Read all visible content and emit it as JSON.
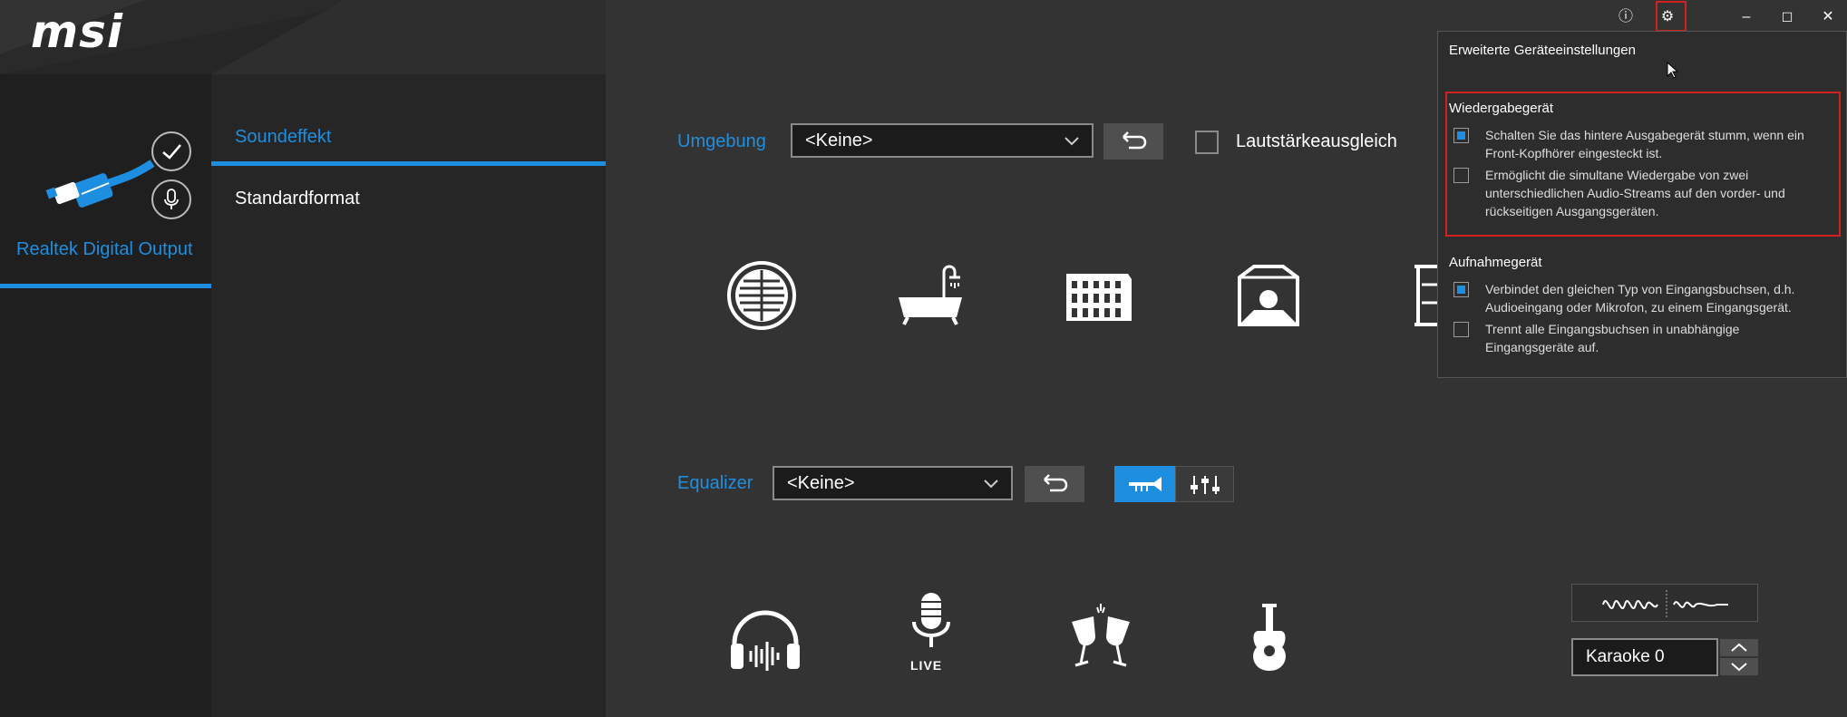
{
  "window": {
    "logo_text": "msi",
    "controls": {
      "info": "ⓘ",
      "settings": "⚙",
      "minimize": "–",
      "maximize": "☐",
      "close": "✕"
    }
  },
  "device": {
    "name": "Realtek Digital Output"
  },
  "nav": {
    "items": [
      {
        "label": "Soundeffekt",
        "selected": true
      },
      {
        "label": "Standardformat",
        "selected": false
      }
    ]
  },
  "environment": {
    "label": "Umgebung",
    "selected": "<Keine>",
    "loudness_label": "Lautstärkeausgleich",
    "loudness_checked": false,
    "icons": [
      "underwater-icon",
      "bathroom-icon",
      "colosseum-icon",
      "room-icon",
      "hall-icon"
    ]
  },
  "equalizer": {
    "label": "Equalizer",
    "selected": "<Keine>",
    "icons": [
      "headphones-icon",
      "live-microphone-icon",
      "party-glasses-icon",
      "guitar-icon"
    ],
    "live_text": "LIVE"
  },
  "karaoke": {
    "value": "Karaoke 0"
  },
  "popup": {
    "title": "Erweiterte Geräteeinstellungen",
    "playback": {
      "heading": "Wiedergabegerät",
      "options": [
        {
          "checked": true,
          "text_1": "Schalten Sie das hintere Ausgabegerät stumm, wenn ein",
          "text_2": "Front-Kopfhörer eingesteckt ist.",
          "text_3": ""
        },
        {
          "checked": false,
          "text_1": "Ermöglicht die simultane Wiedergabe von zwei",
          "text_2": "unterschiedlichen Audio-Streams auf den vorder- und",
          "text_3": "rückseitigen Ausgangsgeräten."
        }
      ]
    },
    "recording": {
      "heading": "Aufnahmegerät",
      "options": [
        {
          "checked": true,
          "text_1": "Verbindet den gleichen Typ von Eingangsbuchsen, d.h.",
          "text_2": "Audioeingang oder Mikrofon, zu einem Eingangsgerät."
        },
        {
          "checked": false,
          "text_1": "Trennt alle Eingangsbuchsen in unabhängige",
          "text_2": "Eingangsgeräte auf."
        }
      ]
    }
  },
  "colors": {
    "accent": "#1e8fe0",
    "highlight": "#d02020"
  }
}
